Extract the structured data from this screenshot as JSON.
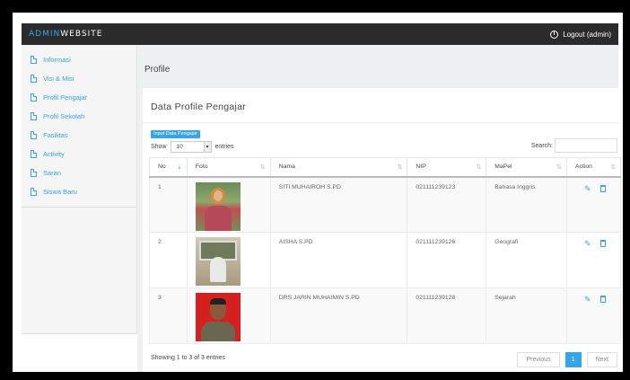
{
  "header": {
    "brand_accent": "ADMIN",
    "brand_rest": "WEBSITE",
    "logout_label": "Logout (admin)"
  },
  "sidebar": {
    "items": [
      {
        "label": "Informasi"
      },
      {
        "label": "Visi & Misi"
      },
      {
        "label": "Profil Pengajar"
      },
      {
        "label": "Profil Sekolah"
      },
      {
        "label": "Fasilitas"
      },
      {
        "label": "Activity"
      },
      {
        "label": "Saran"
      },
      {
        "label": "Siswa Baru"
      }
    ]
  },
  "page": {
    "title": "Profile"
  },
  "panel": {
    "title": "Data Profile Pengajar",
    "input_button": "Input Data Pengajar",
    "show_label": "Show",
    "show_value": "10",
    "entries_label": "entries",
    "search_label": "Search:"
  },
  "table": {
    "headers": [
      "No",
      "Foto",
      "Nama",
      "NIP",
      "MaPel",
      "Action"
    ],
    "rows": [
      {
        "no": "1",
        "nama": "SITI MUHAIROH S.PD",
        "nip": "021111239123",
        "mapel": "Bahasa Inggris"
      },
      {
        "no": "2",
        "nama": "AISHA S.PD",
        "nip": "021111239126",
        "mapel": "Geografi"
      },
      {
        "no": "3",
        "nama": "DRS JARIN MUHAIMIN S.PD",
        "nip": "021111239128",
        "mapel": "Sejarah"
      }
    ]
  },
  "footer": {
    "info": "Showing 1 to 3 of 3 entries",
    "previous": "Previous",
    "current_page": "1",
    "next": "Next"
  },
  "colors": {
    "accent": "#35a4e8",
    "topbar": "#2b2b2b"
  },
  "icons": {
    "row_actions": [
      "pencil-icon",
      "trash-icon"
    ],
    "sidebar_item": "file-icon"
  }
}
